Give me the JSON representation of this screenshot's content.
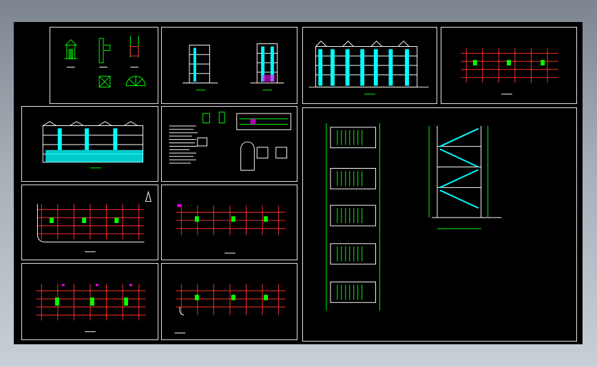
{
  "colors": {
    "background": "#000000",
    "frame": "#e8e8e8",
    "line_white": "#ffffff",
    "line_green": "#00ff00",
    "line_red": "#ff3030",
    "line_cyan": "#00ffff",
    "line_magenta": "#ff00ff",
    "accent_blue": "#2255ff"
  },
  "sheets": [
    {
      "id": "details-gatehouse"
    },
    {
      "id": "side-elevations"
    },
    {
      "id": "front-elevation"
    },
    {
      "id": "plan-roof"
    },
    {
      "id": "rear-elevation"
    },
    {
      "id": "notes-details"
    },
    {
      "id": "plan-ground"
    },
    {
      "id": "plan-typical-a"
    },
    {
      "id": "plan-typical-b"
    },
    {
      "id": "plan-typical-c"
    },
    {
      "id": "stair-details"
    }
  ]
}
